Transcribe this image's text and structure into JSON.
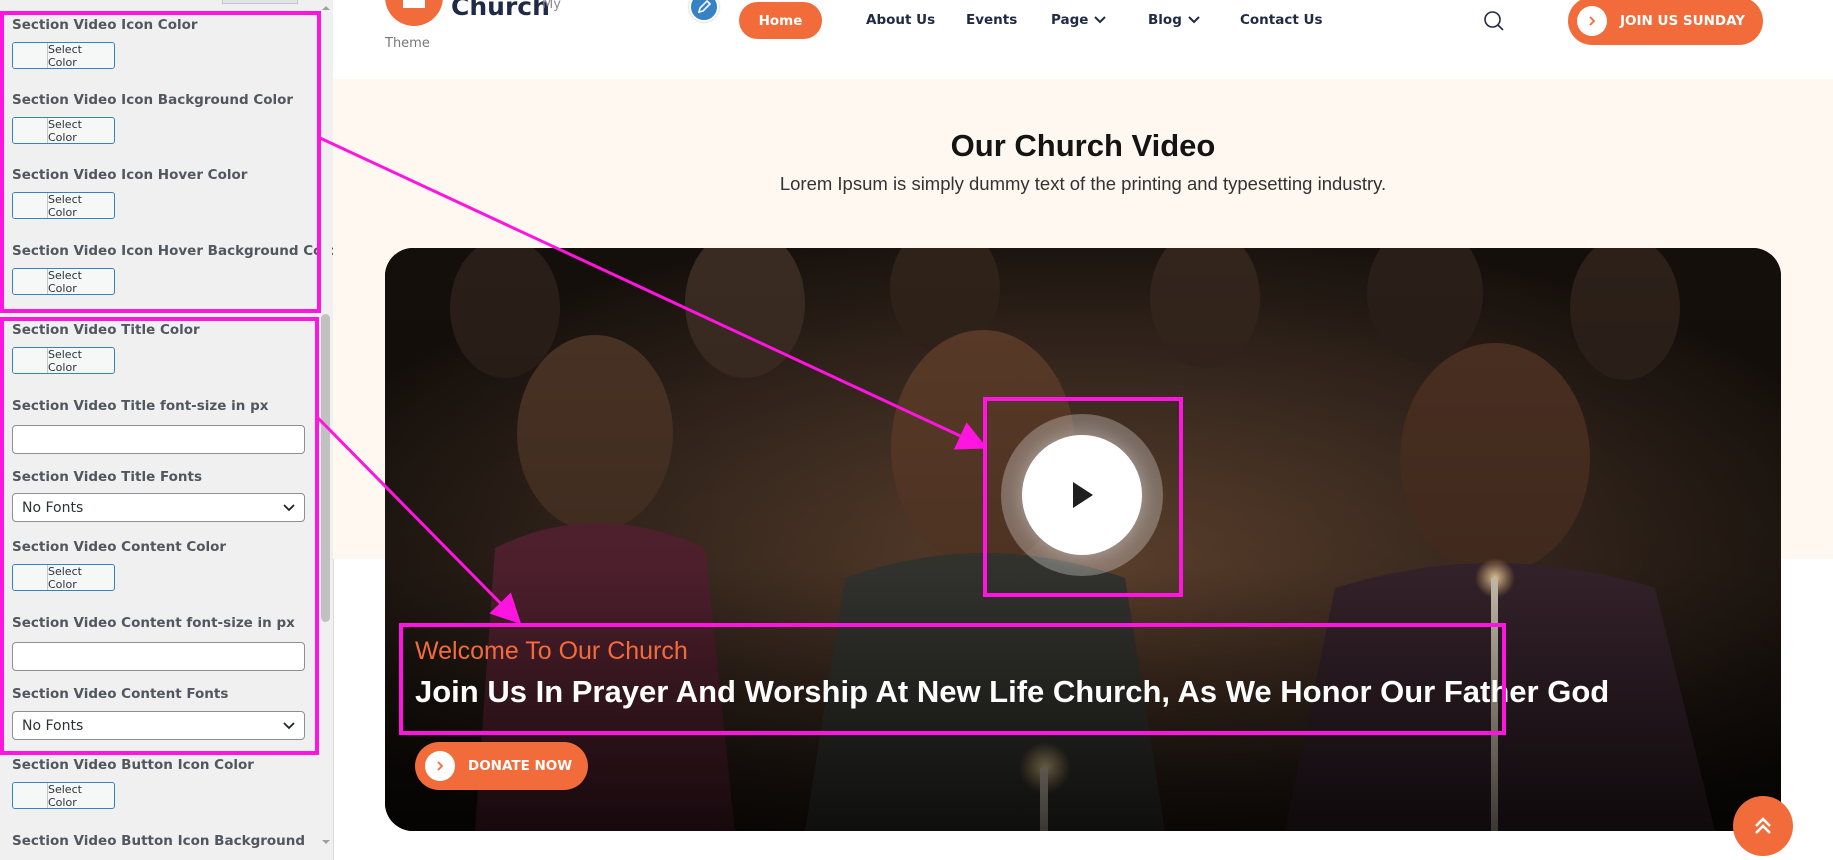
{
  "customizer": {
    "fields": [
      {
        "label": "Section Video Icon Color",
        "type": "color",
        "button": "Select Color"
      },
      {
        "label": "Section Video Icon Background Color",
        "type": "color",
        "button": "Select Color"
      },
      {
        "label": "Section Video Icon Hover Color",
        "type": "color",
        "button": "Select Color"
      },
      {
        "label": "Section Video Icon Hover Background Color",
        "type": "color",
        "button": "Select Color"
      },
      {
        "label": "Section Video Title Color",
        "type": "color",
        "button": "Select Color"
      },
      {
        "label": "Section Video Title font-size in px",
        "type": "text",
        "value": ""
      },
      {
        "label": "Section Video Title Fonts",
        "type": "select",
        "value": "No Fonts"
      },
      {
        "label": "Section Video Content Color",
        "type": "color",
        "button": "Select Color"
      },
      {
        "label": "Section Video Content font-size in px",
        "type": "text",
        "value": ""
      },
      {
        "label": "Section Video Content Fonts",
        "type": "select",
        "value": "No Fonts"
      },
      {
        "label": "Section Video Button Icon Color",
        "type": "color",
        "button": "Select Color"
      },
      {
        "label": "Section Video Button Icon Background",
        "type": "partial"
      }
    ]
  },
  "site": {
    "logo": {
      "text": "Church",
      "superscript": "My",
      "subtitle": "Theme"
    },
    "nav": {
      "home": "Home",
      "about": "About Us",
      "events": "Events",
      "page": "Page",
      "blog": "Blog",
      "contact": "Contact Us"
    },
    "join_button": "JOIN US SUNDAY",
    "section_title": "Our Church Video",
    "section_subtitle": "Lorem Ipsum is simply dummy text of the printing and typesetting industry.",
    "video": {
      "subtitle": "Welcome To Our Church",
      "title": "Join Us In Prayer And Worship At New Life Church, As We Honor Our Father God",
      "donate_button": "DONATE NOW"
    }
  },
  "colors": {
    "accent": "#f26b3a",
    "annotation": "#ff14e0",
    "nav_text": "#1f2a44",
    "section_bg": "#fff8f0"
  }
}
